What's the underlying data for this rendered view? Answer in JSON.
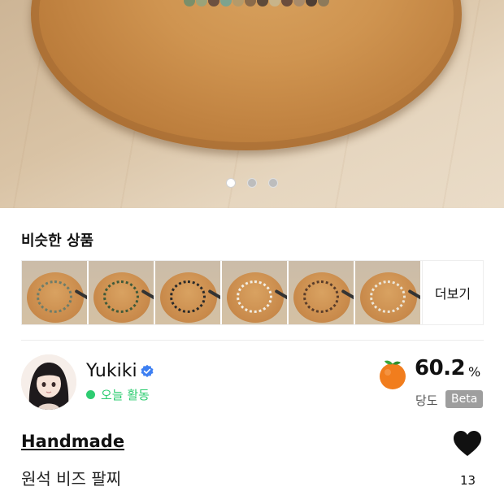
{
  "gallery": {
    "page_count": 3,
    "active_page": 1
  },
  "similar": {
    "title": "비슷한 상품",
    "more_label": "더보기",
    "thumbnail_count": 6
  },
  "seller": {
    "name": "Yukiki",
    "verified": true,
    "activity_status": "오늘 활동",
    "status_color": "#2ecc71"
  },
  "sweetness": {
    "value": "60.2",
    "unit": "%",
    "label": "당도",
    "badge": "Beta",
    "icon": "orange-fruit-icon"
  },
  "product": {
    "category": "Handmade",
    "title": "원석 비즈 팔찌",
    "like_count": "13"
  },
  "colors": {
    "accent_green": "#2ecc71",
    "verified_blue": "#3d7ff2",
    "fruit_orange": "#f17d1d"
  }
}
